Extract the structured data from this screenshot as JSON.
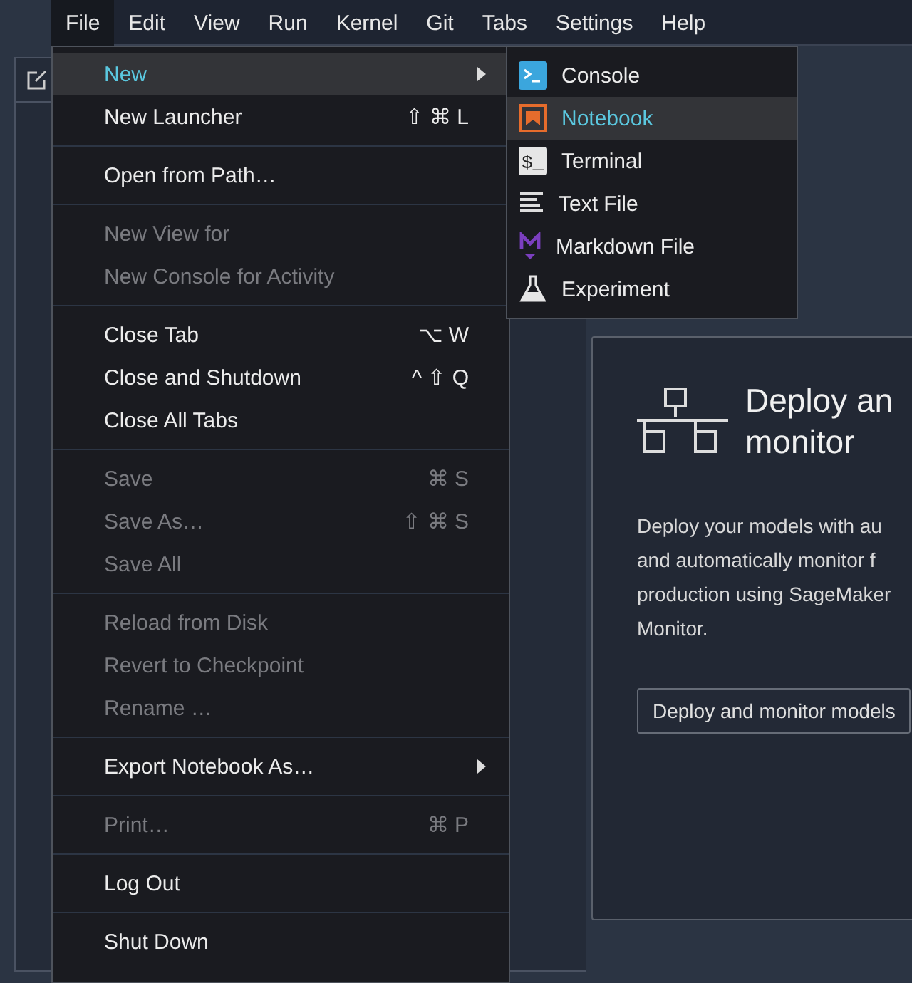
{
  "menubar": [
    {
      "label": "File",
      "selected": true
    },
    {
      "label": "Edit",
      "selected": false
    },
    {
      "label": "View",
      "selected": false
    },
    {
      "label": "Run",
      "selected": false
    },
    {
      "label": "Kernel",
      "selected": false
    },
    {
      "label": "Git",
      "selected": false
    },
    {
      "label": "Tabs",
      "selected": false
    },
    {
      "label": "Settings",
      "selected": false
    },
    {
      "label": "Help",
      "selected": false
    }
  ],
  "file_menu": [
    [
      {
        "label": "New",
        "selected": true,
        "disabled": false,
        "submenu": true
      },
      {
        "label": "New Launcher",
        "shortcut": "⇧ ⌘ L",
        "selected": false,
        "disabled": false,
        "submenu": false
      }
    ],
    [
      {
        "label": "Open from Path…",
        "selected": false,
        "disabled": false,
        "submenu": false
      }
    ],
    [
      {
        "label": "New View for",
        "selected": false,
        "disabled": true,
        "submenu": false
      },
      {
        "label": "New Console for Activity",
        "selected": false,
        "disabled": true,
        "submenu": false
      }
    ],
    [
      {
        "label": "Close Tab",
        "shortcut": "⌥ W",
        "selected": false,
        "disabled": false,
        "submenu": false
      },
      {
        "label": "Close and Shutdown",
        "shortcut": "^ ⇧ Q",
        "selected": false,
        "disabled": false,
        "submenu": false
      },
      {
        "label": "Close All Tabs",
        "selected": false,
        "disabled": false,
        "submenu": false
      }
    ],
    [
      {
        "label": "Save",
        "shortcut": "⌘ S",
        "selected": false,
        "disabled": true,
        "submenu": false
      },
      {
        "label": "Save As…",
        "shortcut": "⇧ ⌘ S",
        "selected": false,
        "disabled": true,
        "submenu": false
      },
      {
        "label": "Save All",
        "selected": false,
        "disabled": true,
        "submenu": false
      }
    ],
    [
      {
        "label": "Reload from Disk",
        "selected": false,
        "disabled": true,
        "submenu": false
      },
      {
        "label": "Revert to Checkpoint",
        "selected": false,
        "disabled": true,
        "submenu": false
      },
      {
        "label": "Rename …",
        "selected": false,
        "disabled": true,
        "submenu": false
      }
    ],
    [
      {
        "label": "Export Notebook As…",
        "selected": false,
        "disabled": false,
        "submenu": true
      }
    ],
    [
      {
        "label": "Print…",
        "shortcut": "⌘ P",
        "selected": false,
        "disabled": true,
        "submenu": false
      }
    ],
    [
      {
        "label": "Log Out",
        "selected": false,
        "disabled": false,
        "submenu": false
      }
    ],
    [
      {
        "label": "Shut Down",
        "selected": false,
        "disabled": false,
        "submenu": false
      }
    ]
  ],
  "new_submenu": [
    {
      "label": "Console",
      "kind": "console",
      "selected": false
    },
    {
      "label": "Notebook",
      "kind": "notebook",
      "selected": true
    },
    {
      "label": "Terminal",
      "kind": "terminal",
      "icon_text": "$_",
      "selected": false
    },
    {
      "label": "Text File",
      "kind": "text",
      "selected": false
    },
    {
      "label": "Markdown File",
      "kind": "markdown",
      "selected": false
    },
    {
      "label": "Experiment",
      "kind": "experiment",
      "selected": false
    }
  ],
  "card": {
    "title_lines": [
      "Deploy an",
      "monitor"
    ],
    "description_lines": [
      "Deploy your models with au",
      "and automatically monitor f",
      "production using SageMaker",
      "Monitor."
    ],
    "button": "Deploy and monitor models"
  }
}
